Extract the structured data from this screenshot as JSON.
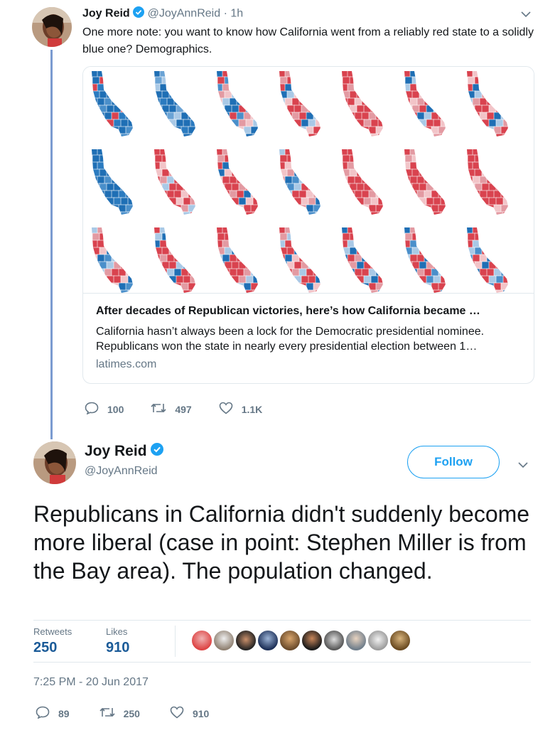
{
  "tweet1": {
    "name": "Joy Reid",
    "handle": "@JoyAnnReid",
    "time": "1h",
    "text": "One more note: you want to know how California went from a reliably red state to a solidly blue one? Demographics.",
    "card": {
      "title": "After decades of Republican victories, here’s how California became …",
      "description": "California hasn’t always been a lock for the Democratic presidential nominee. Republicans won the state in nearly every presidential election between 1…",
      "domain": "latimes.com"
    },
    "actions": {
      "replies": "100",
      "retweets": "497",
      "likes": "1.1K"
    }
  },
  "tweet2": {
    "name": "Joy Reid",
    "handle": "@JoyAnnReid",
    "follow_label": "Follow",
    "text": "Republicans in California didn't suddenly become more liberal (case in point: Stephen Miller is from the Bay area). The population changed.",
    "stats": {
      "retweets_label": "Retweets",
      "retweets_value": "250",
      "likes_label": "Likes",
      "likes_value": "910"
    },
    "timestamp": "7:25 PM - 20 Jun 2017",
    "actions": {
      "replies": "89",
      "retweets": "250",
      "likes": "910"
    }
  },
  "colors": {
    "accent": "#1da1f2",
    "muted": "#657786",
    "stat_value": "#1b5b98",
    "thread_line": "#7b9bd0",
    "map_red": "#d9434f",
    "map_blue": "#1f77b4"
  },
  "icons": [
    "verified-badge-icon",
    "chevron-down-icon",
    "reply-icon",
    "retweet-icon",
    "like-icon"
  ]
}
